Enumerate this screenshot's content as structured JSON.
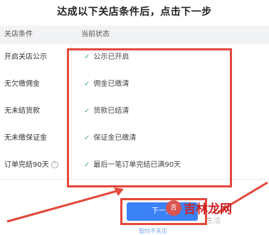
{
  "page": {
    "title": "达成以下关店条件后，点击下一步"
  },
  "table": {
    "headers": {
      "condition": "关店条件",
      "status": "当前状态"
    },
    "rows": [
      {
        "condition": "开启关店公示",
        "status": "公示已开启"
      },
      {
        "condition": "无欠缴佣金",
        "status": "佣金已缴清"
      },
      {
        "condition": "无未结货款",
        "status": "货款已结清"
      },
      {
        "condition": "无未缴保证金",
        "status": "保证金已缴清"
      },
      {
        "condition": "订单完结90天",
        "status": "最后一笔订单完结已满90天"
      }
    ]
  },
  "actions": {
    "next_label": "下一步",
    "footer_link": "暂时不关店"
  },
  "watermark": {
    "text": "吉林龙网",
    "sub": "生活"
  },
  "colors": {
    "accent": "#3b82f6",
    "highlight": "#e4473c",
    "check": "#3cb371"
  }
}
